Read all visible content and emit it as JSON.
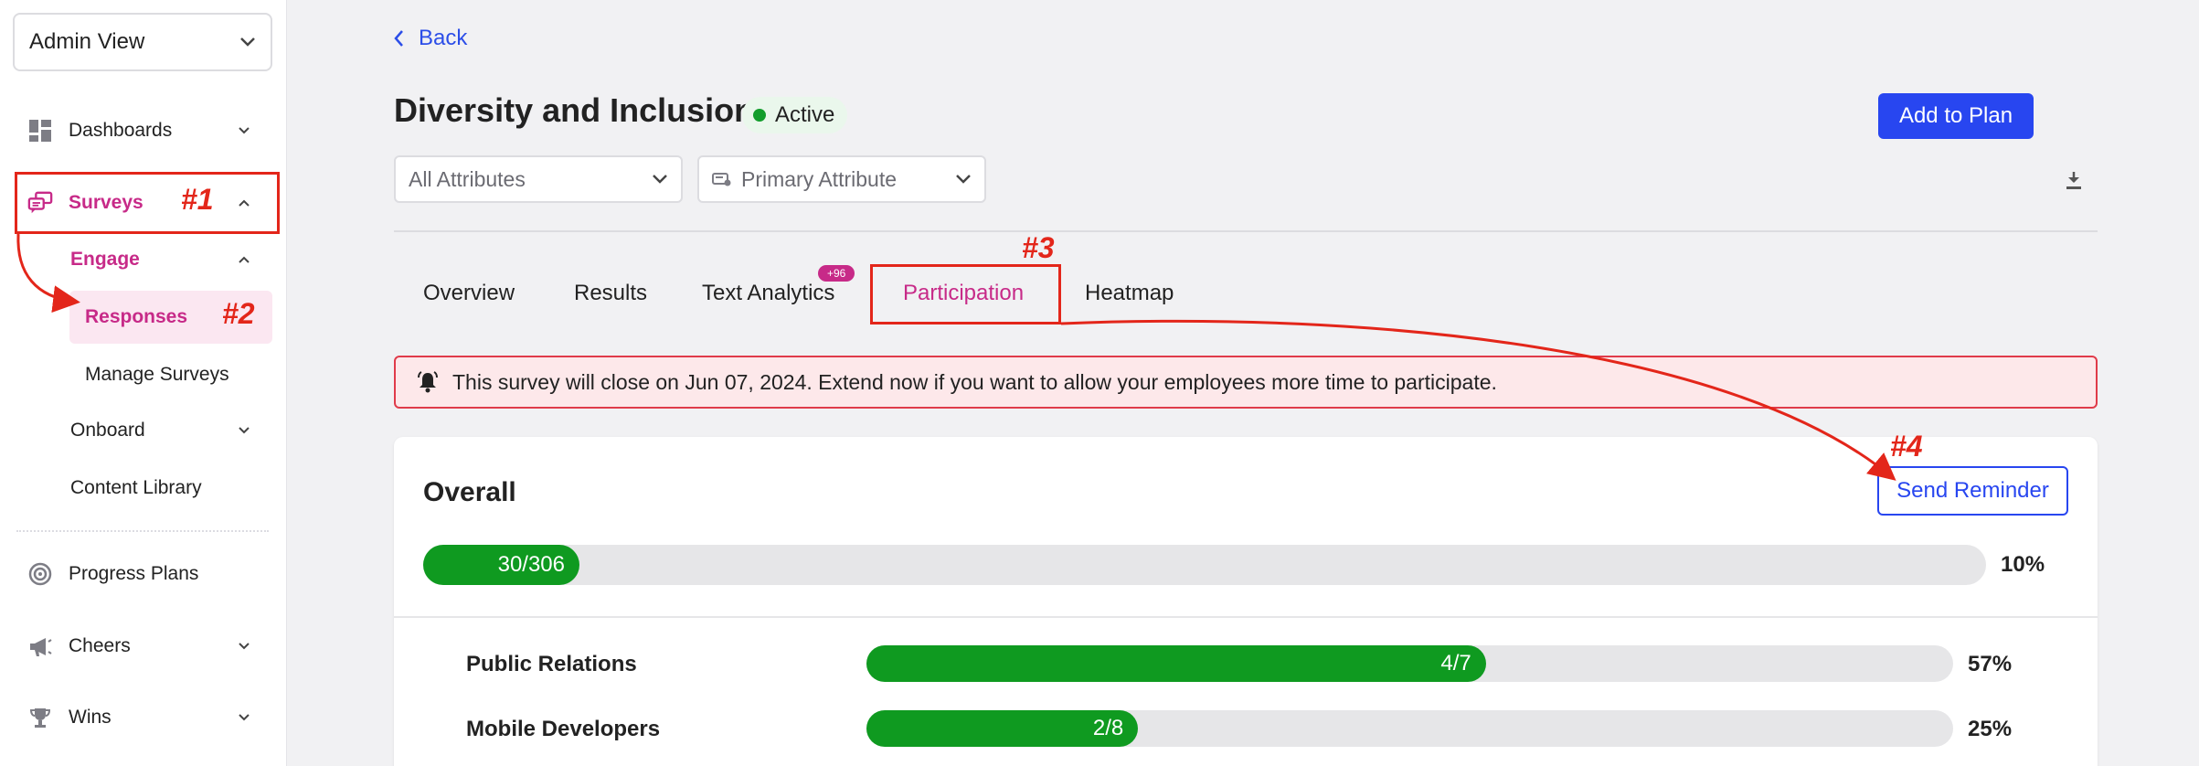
{
  "sidebar": {
    "view_select": "Admin View",
    "items": [
      {
        "label": "Dashboards",
        "icon": "dashboard-icon"
      },
      {
        "label": "Surveys",
        "icon": "survey-icon"
      },
      {
        "label": "Engage"
      },
      {
        "label": "Responses"
      },
      {
        "label": "Manage Surveys"
      },
      {
        "label": "Onboard"
      },
      {
        "label": "Content Library"
      },
      {
        "label": "Progress Plans",
        "icon": "target-icon"
      },
      {
        "label": "Cheers",
        "icon": "megaphone-icon"
      },
      {
        "label": "Wins",
        "icon": "trophy-icon"
      }
    ]
  },
  "header": {
    "back_label": "Back",
    "title": "Diversity and Inclusion",
    "status": "Active",
    "add_to_plan": "Add to Plan"
  },
  "filters": {
    "attributes": "All Attributes",
    "primary_attribute": "Primary Attribute"
  },
  "tabs": [
    {
      "label": "Overview"
    },
    {
      "label": "Results"
    },
    {
      "label": "Text Analytics",
      "badge": "+96"
    },
    {
      "label": "Participation"
    },
    {
      "label": "Heatmap"
    }
  ],
  "alert": {
    "text": "This survey will close on Jun 07, 2024. Extend now if you want to allow your employees more time to participate."
  },
  "overall": {
    "title": "Overall",
    "send_reminder": "Send Reminder",
    "count": "30/306",
    "percent": "10%",
    "fraction": 0.1
  },
  "departments": [
    {
      "name": "Public Relations",
      "count": "4/7",
      "percent": "57%",
      "fraction": 0.57
    },
    {
      "name": "Mobile Developers",
      "count": "2/8",
      "percent": "25%",
      "fraction": 0.25
    }
  ],
  "annotations": [
    "#1",
    "#2",
    "#3",
    "#4"
  ],
  "colors": {
    "accent_pink": "#c72a88",
    "primary_blue": "#2846f0",
    "success_green": "#0f9a20",
    "annotation_red": "#e3261a"
  }
}
